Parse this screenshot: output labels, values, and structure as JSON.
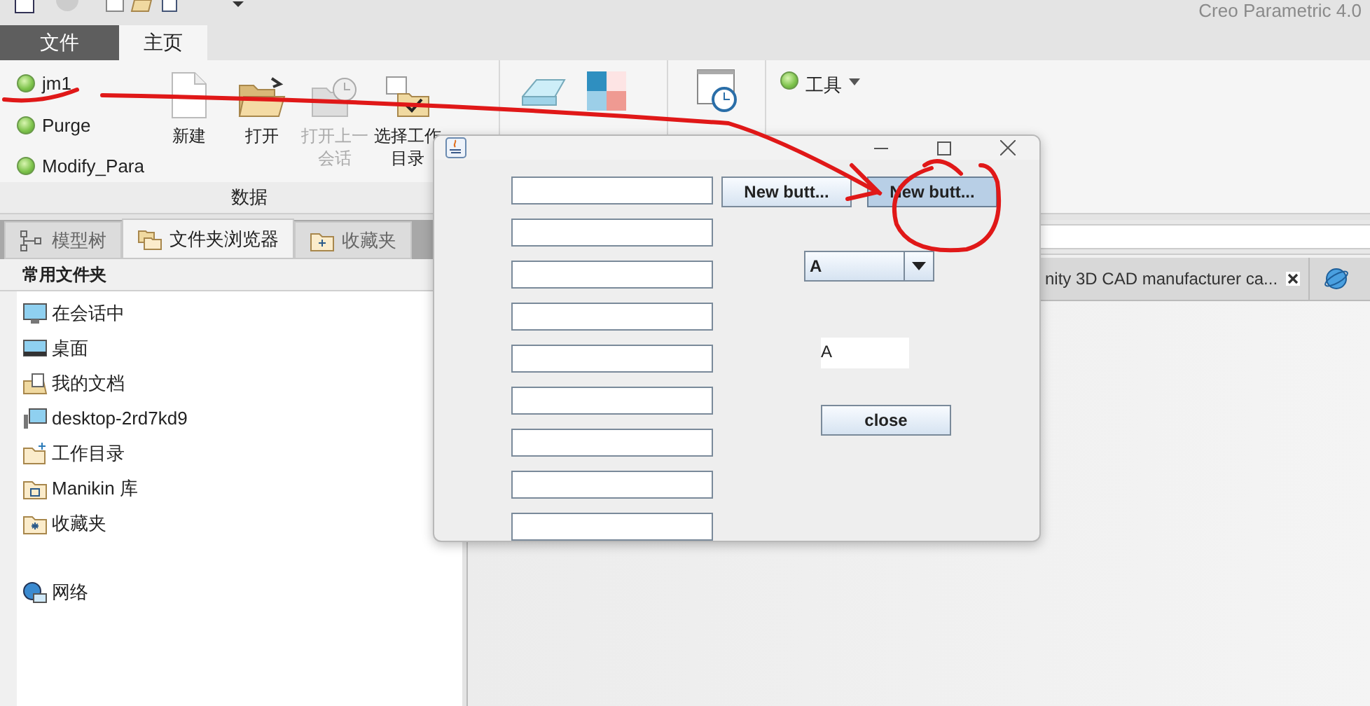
{
  "app_title": "Creo Parametric 4.0",
  "ribbon_tabs": [
    {
      "label": "文件",
      "kind": "file",
      "selected": false
    },
    {
      "label": "主页",
      "kind": "page",
      "selected": true
    }
  ],
  "ribbon": {
    "tools": [
      {
        "label": "jm1"
      },
      {
        "label": "Purge"
      },
      {
        "label": "Modify_Para"
      }
    ],
    "commands": [
      {
        "label": "新建",
        "kind": "new",
        "disabled": false
      },
      {
        "label": "打开",
        "kind": "open",
        "disabled": false
      },
      {
        "label": "打开上一会话",
        "kind": "recent",
        "disabled": true
      },
      {
        "label": "选择工作目录",
        "kind": "workdir",
        "disabled": false
      }
    ],
    "group_label": "数据",
    "tools_menu": "工具"
  },
  "panel_tabs": [
    {
      "label": "模型树",
      "kind": "tree",
      "selected": false
    },
    {
      "label": "文件夹浏览器",
      "kind": "folders",
      "selected": true
    },
    {
      "label": "收藏夹",
      "kind": "favorites",
      "selected": false
    }
  ],
  "folders": {
    "heading": "常用文件夹",
    "items": [
      {
        "label": "在会话中",
        "kind": "session"
      },
      {
        "label": "桌面",
        "kind": "desktop"
      },
      {
        "label": "我的文档",
        "kind": "documents"
      },
      {
        "label": "desktop-2rd7kd9",
        "kind": "computer"
      },
      {
        "label": "工作目录",
        "kind": "workdir"
      },
      {
        "label": "Manikin 库",
        "kind": "library"
      },
      {
        "label": "收藏夹",
        "kind": "favorites"
      },
      {
        "label": "网络",
        "kind": "network"
      }
    ]
  },
  "browser_tab": {
    "label": "nity 3D CAD manufacturer ca..."
  },
  "dialog": {
    "text_fields": [
      {
        "disabled": false
      },
      {
        "disabled": false
      },
      {
        "disabled": false
      },
      {
        "disabled": false
      },
      {
        "disabled": false
      },
      {
        "disabled": false
      },
      {
        "disabled": false
      },
      {
        "disabled": false
      },
      {
        "disabled": false
      }
    ],
    "buttons": [
      {
        "label": "New butt...",
        "selected": false
      },
      {
        "label": "New butt...",
        "selected": true
      }
    ],
    "combo": {
      "value": "A"
    },
    "label": "A",
    "close_button": "close"
  }
}
